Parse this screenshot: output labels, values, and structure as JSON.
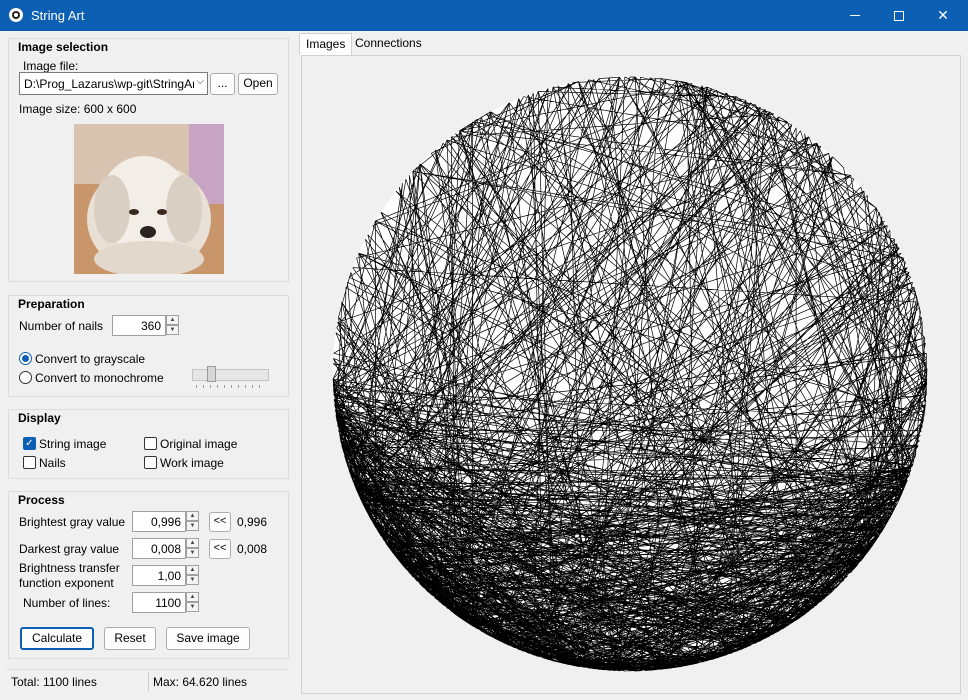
{
  "window": {
    "title": "String Art"
  },
  "image_selection": {
    "title": "Image selection",
    "file_label": "Image file:",
    "file_value": "D:\\Prog_Lazarus\\wp-git\\StringArt",
    "browse_label": "...",
    "open_label": "Open",
    "image_size": "Image size: 600 x 600"
  },
  "preparation": {
    "title": "Preparation",
    "nails_label": "Number of nails",
    "nails_value": "360",
    "grayscale_label": "Convert to grayscale",
    "grayscale_selected": true,
    "monochrome_label": "Convert to monochrome",
    "threshold_fraction": 0.2
  },
  "display": {
    "title": "Display",
    "string_image": {
      "label": "String image",
      "checked": true
    },
    "original_image": {
      "label": "Original image",
      "checked": false
    },
    "nails": {
      "label": "Nails",
      "checked": false
    },
    "work_image": {
      "label": "Work image",
      "checked": false
    }
  },
  "process": {
    "title": "Process",
    "brightest_label": "Brightest gray value",
    "brightest_value": "0,996",
    "brightest_copy": "0,996",
    "darkest_label": "Darkest gray value",
    "darkest_value": "0,008",
    "darkest_copy": "0,008",
    "copy_label": "<<",
    "exponent_label_1": "Brightness transfer",
    "exponent_label_2": "function exponent",
    "exponent_value": "1,00",
    "lines_label": "Number of lines:",
    "lines_value": "1100",
    "calculate_label": "Calculate",
    "reset_label": "Reset",
    "save_label": "Save image"
  },
  "status": {
    "total": "Total: 1100 lines",
    "max": "Max: 64.620 lines"
  },
  "tabs": [
    {
      "label": "Images",
      "active": true
    },
    {
      "label": "Connections",
      "active": false
    }
  ],
  "string_art": {
    "nails": 360,
    "lines": 1100,
    "color": "#000000"
  }
}
